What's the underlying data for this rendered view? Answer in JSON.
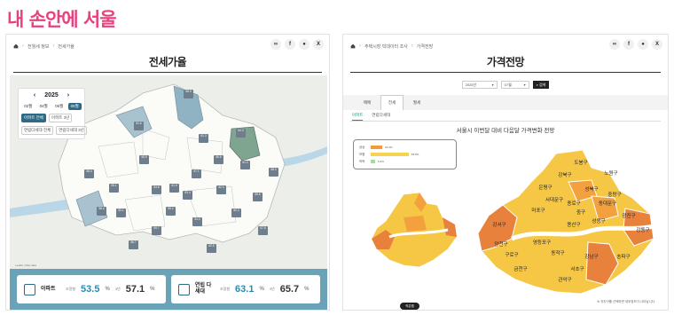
{
  "logo": "내 손안에 서울",
  "left": {
    "breadcrumbs": [
      "전월세 정보",
      "전세가율"
    ],
    "title": "전세가율",
    "year": "2025",
    "months": [
      "02월",
      "04월",
      "06월",
      "08월"
    ],
    "active_month": "08월",
    "types": [
      "아파트 전체",
      "아파트 3년",
      "연립다세대 전체",
      "연립다세대 3년"
    ],
    "pins": [
      "58.9",
      "51.6",
      "54.3",
      "61.3",
      "55.9",
      "53.8",
      "58.5",
      "61.2",
      "58.4",
      "57.1",
      "52.3",
      "55.6",
      "53.1",
      "59.2",
      "56.7",
      "54.0",
      "60.3",
      "57.8",
      "58.0",
      "61.9",
      "62.5",
      "55.1",
      "53.4",
      "56.6",
      "59.7"
    ],
    "stats": [
      {
        "name": "아파트",
        "label1": "조정형",
        "value1": "53.5",
        "label2": "3년",
        "value2": "57.1",
        "unit": "%"
      },
      {
        "name": "연립 다세대",
        "label1": "조정형",
        "value1": "63.1",
        "label2": "3년",
        "value2": "65.7",
        "unit": "%"
      }
    ],
    "map_attribution": "Leaflet | Map data"
  },
  "right": {
    "breadcrumbs": [
      "주택시장 빅데이터 조사",
      "가격전망"
    ],
    "title": "가격전망",
    "select_year": "2025년",
    "select_month": "07월",
    "search_label": "검색",
    "tabs": [
      "매매",
      "전세",
      "월세"
    ],
    "active_tab": "전세",
    "subtabs": [
      "아파트",
      "연립다세대"
    ],
    "chart_title": "서울시 이번달 대비 다음달 가격변화 전망",
    "small_map_button": "작은맵",
    "footnote": "※ 자치구를 선택하면 세부정보가 나타납니다.",
    "districts": [
      "도봉구",
      "노원구",
      "강북구",
      "은평구",
      "성북구",
      "중랑구",
      "서대문구",
      "종로구",
      "동대문구",
      "마포구",
      "중구",
      "광진구",
      "강서구",
      "성동구",
      "용산구",
      "강동구",
      "양천구",
      "영등포구",
      "동작구",
      "송파구",
      "구로구",
      "강남구",
      "서초구",
      "금천구",
      "관악구"
    ]
  },
  "chart_data": {
    "type": "bar",
    "categories": [
      "상승",
      "보합",
      "하락"
    ],
    "values": [
      16.2,
      53.5,
      6.3
    ],
    "colors": [
      "#f59a3c",
      "#f6d451",
      "#a7d9a1"
    ],
    "xlim": [
      0,
      100
    ]
  }
}
